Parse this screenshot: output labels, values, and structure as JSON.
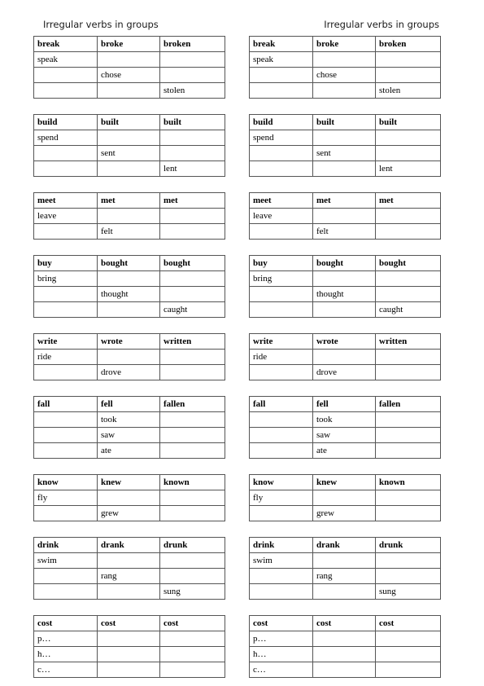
{
  "document": {
    "title": "Irregular verbs in groups",
    "worksheet_type": "fill-in-the-blank verb table",
    "copies": 2
  },
  "sheet": {
    "title": "Irregular verbs in groups"
  },
  "tables": [
    {
      "name": "break-group",
      "header": [
        "break",
        "broke",
        "broken"
      ],
      "rows": [
        [
          "speak",
          "",
          ""
        ],
        [
          "",
          "chose",
          ""
        ],
        [
          "",
          "",
          "stolen"
        ]
      ]
    },
    {
      "name": "build-group",
      "header": [
        "build",
        "built",
        "built"
      ],
      "rows": [
        [
          "spend",
          "",
          ""
        ],
        [
          "",
          "sent",
          ""
        ],
        [
          "",
          "",
          "lent"
        ]
      ]
    },
    {
      "name": "meet-group",
      "header": [
        "meet",
        "met",
        "met"
      ],
      "rows": [
        [
          "leave",
          "",
          ""
        ],
        [
          "",
          "felt",
          ""
        ]
      ]
    },
    {
      "name": "buy-group",
      "header": [
        "buy",
        "bought",
        "bought"
      ],
      "rows": [
        [
          "bring",
          "",
          ""
        ],
        [
          "",
          "thought",
          ""
        ],
        [
          "",
          "",
          "caught"
        ]
      ]
    },
    {
      "name": "write-group",
      "header": [
        "write",
        "wrote",
        "written"
      ],
      "rows": [
        [
          "ride",
          "",
          ""
        ],
        [
          "",
          "drove",
          ""
        ]
      ]
    },
    {
      "name": "fall-group",
      "header": [
        "fall",
        "fell",
        "fallen"
      ],
      "rows": [
        [
          "",
          "took",
          ""
        ],
        [
          "",
          "saw",
          ""
        ],
        [
          "",
          "ate",
          ""
        ]
      ]
    },
    {
      "name": "know-group",
      "header": [
        "know",
        "knew",
        "known"
      ],
      "rows": [
        [
          "fly",
          "",
          ""
        ],
        [
          "",
          "grew",
          ""
        ]
      ]
    },
    {
      "name": "drink-group",
      "header": [
        "drink",
        "drank",
        "drunk"
      ],
      "rows": [
        [
          "swim",
          "",
          ""
        ],
        [
          "",
          "rang",
          ""
        ],
        [
          "",
          "",
          "sung"
        ]
      ]
    },
    {
      "name": "cost-group",
      "header": [
        "cost",
        "cost",
        "cost"
      ],
      "rows": [
        [
          "p…",
          "",
          ""
        ],
        [
          "h…",
          "",
          ""
        ],
        [
          "c…",
          "",
          ""
        ]
      ]
    }
  ],
  "colors": {
    "page_background": "#ffffff",
    "text": "#000000",
    "title_text": "#1a1a1a",
    "table_border": "#555555"
  }
}
